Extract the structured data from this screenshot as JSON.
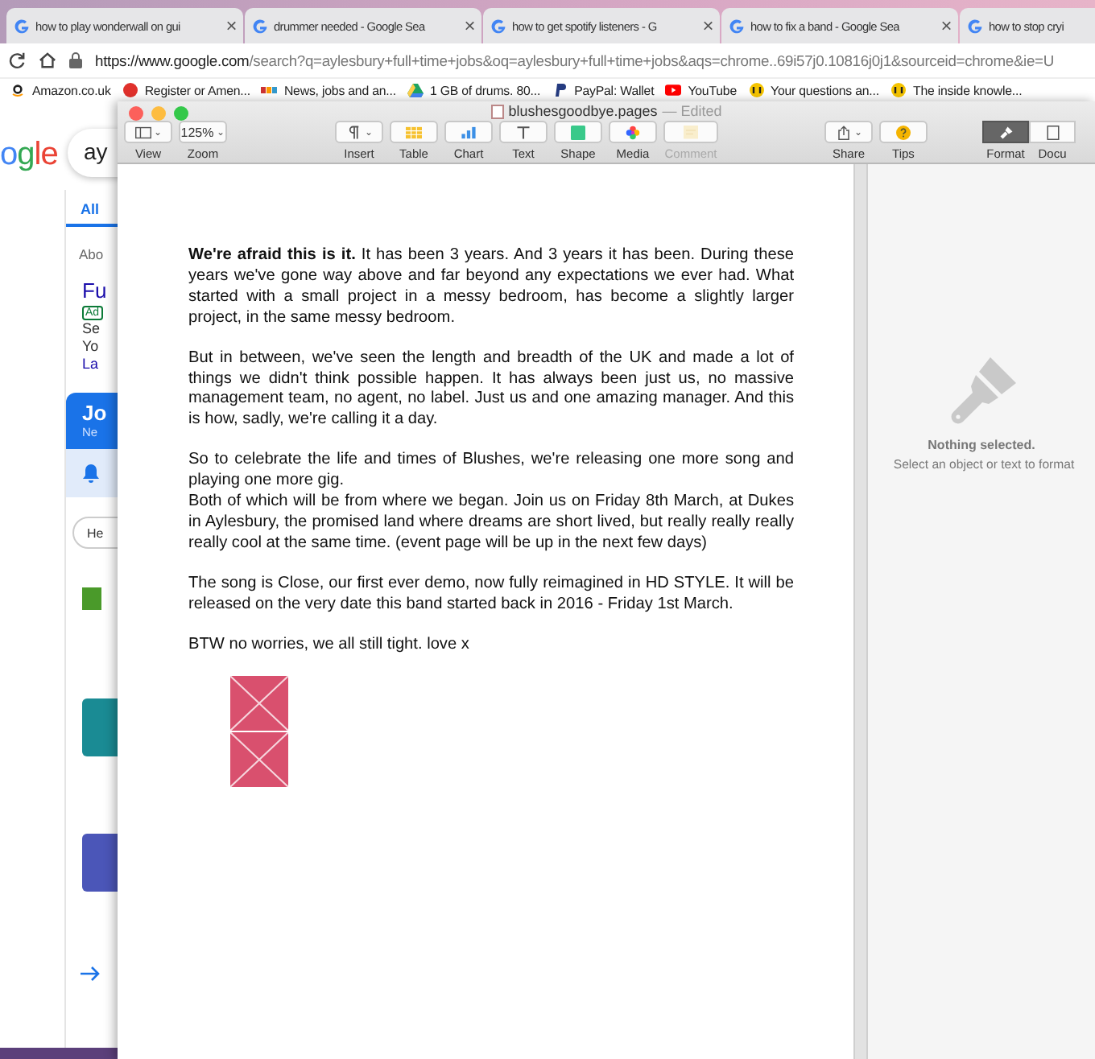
{
  "browser": {
    "tabs": [
      {
        "title": "how to play wonderwall on gui",
        "close": "×"
      },
      {
        "title": "drummer needed - Google Sea",
        "close": "×"
      },
      {
        "title": "how to get spotify listeners - G",
        "close": "×"
      },
      {
        "title": "how to fix a band - Google Sea",
        "close": "×"
      },
      {
        "title": "how to stop cryi"
      }
    ],
    "address": {
      "host": "https://www.google.com",
      "path": "/search?q=aylesbury+full+time+jobs&oq=aylesbury+full+time+jobs&aqs=chrome..69i57j0.10816j0j1&sourceid=chrome&ie=U"
    },
    "bookmarks": [
      {
        "label": "Amazon.co.uk",
        "kind": "amazon"
      },
      {
        "label": "Register or Amen...",
        "kind": "red"
      },
      {
        "label": "News, jobs and an...",
        "kind": "stripes"
      },
      {
        "label": "1 GB of drums. 80...",
        "kind": "drive"
      },
      {
        "label": "PayPal: Wallet",
        "kind": "paypal"
      },
      {
        "label": "YouTube",
        "kind": "youtube"
      },
      {
        "label": "Your questions an...",
        "kind": "yellow"
      },
      {
        "label": "The inside knowle...",
        "kind": "yellow"
      }
    ]
  },
  "google_page": {
    "logo": "ogle",
    "search_value": "ay",
    "tab": "All",
    "about": "Abo",
    "result_title": "Fu",
    "badge": "Ad",
    "result_lines": [
      "Se",
      "Yo",
      "La"
    ],
    "jobs_title": "Jo",
    "jobs_subtitle": "Ne",
    "chip": "He"
  },
  "pages_window": {
    "title": "blushesgoodbye.pages",
    "status": "— Edited",
    "toolbar_left": [
      {
        "label": "View",
        "kind": "view",
        "caret": "⌄"
      },
      {
        "label": "Zoom",
        "kind": "zoom",
        "value": "125%",
        "caret": "⌄"
      }
    ],
    "toolbar_center": [
      {
        "label": "Insert",
        "kind": "insert",
        "disabled": false,
        "caret": "⌄"
      },
      {
        "label": "Table",
        "kind": "table",
        "disabled": false
      },
      {
        "label": "Chart",
        "kind": "chart",
        "disabled": false
      },
      {
        "label": "Text",
        "kind": "text",
        "disabled": false
      },
      {
        "label": "Shape",
        "kind": "shape",
        "disabled": false
      },
      {
        "label": "Media",
        "kind": "media",
        "disabled": false
      },
      {
        "label": "Comment",
        "kind": "comment",
        "disabled": true
      }
    ],
    "toolbar_right": [
      {
        "label": "Share",
        "kind": "share",
        "caret": "⌄"
      },
      {
        "label": "Tips",
        "kind": "tips"
      }
    ],
    "inspector_tabs": [
      {
        "label": "Format",
        "kind": "format",
        "selected": true
      },
      {
        "label": "Docu",
        "kind": "document",
        "selected": false
      }
    ],
    "document": {
      "paragraphs": [
        {
          "lines": [
            "**We're afraid this is it.**  It has been 3 years. And 3 years it has been. During these years we've gone way above and far beyond any expectations we ever had. What started with a small project in a messy bedroom, has become a slightly larger project, in the same messy bedroom."
          ]
        },
        {
          "lines": [
            "But in between, we've seen the length and breadth of the UK and made a lot of things we didn't think possible happen. It has always been just us, no massive management team, no agent, no label. Just us and one amazing manager. And this is how, sadly, we're calling it a day."
          ]
        },
        {
          "lines": [
            "So to celebrate the life and times of Blushes, we're releasing one more song and playing one more gig.",
            "Both of which will be from where we began. Join us on Friday 8th March, at Dukes in Aylesbury, the promised land where dreams are short lived, but really really really really cool at the same time. (event page will be up in the next few days)"
          ]
        },
        {
          "lines": [
            "The song is Close, our first ever demo, now fully reimagined in HD STYLE. It will be released on the very date this band started back in 2016 - Friday 1st March."
          ]
        },
        {
          "lines": [
            "BTW no worries, we all still tight. love x"
          ]
        }
      ]
    },
    "inspector": {
      "title": "Nothing selected.",
      "hint": "Select an object or text to format"
    }
  }
}
